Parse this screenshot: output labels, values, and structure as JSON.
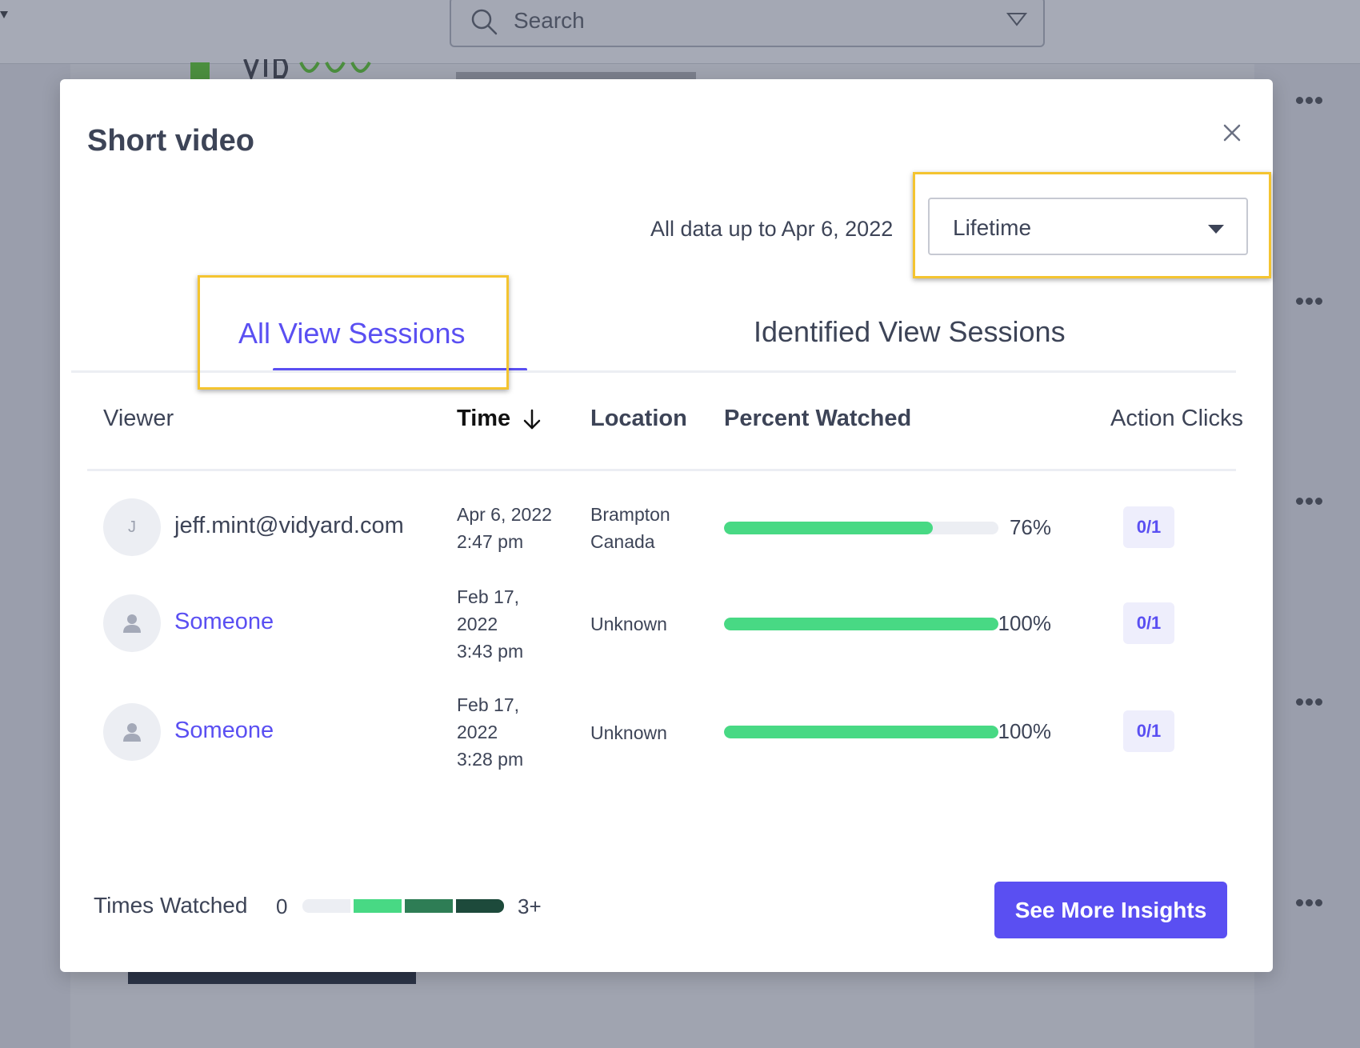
{
  "background": {
    "search_placeholder": "Search"
  },
  "modal": {
    "title": "Short video",
    "data_note": "All data up to Apr 6, 2022",
    "range_select": {
      "value": "Lifetime"
    },
    "tabs": [
      {
        "label": "All View Sessions",
        "active": true
      },
      {
        "label": "Identified View Sessions",
        "active": false
      }
    ],
    "columns": {
      "viewer": "Viewer",
      "time": "Time",
      "location": "Location",
      "percent": "Percent Watched",
      "actions": "Action Clicks"
    },
    "rows": [
      {
        "avatar_initial": "J",
        "viewer": "jeff.mint@vidyard.com",
        "time_lines": [
          "Apr 6, 2022",
          "2:47 pm"
        ],
        "location_lines": [
          "Brampton",
          "Canada"
        ],
        "percent_value": 0.76,
        "percent_label": "76%",
        "action_clicks": "0/1"
      },
      {
        "avatar_initial": "",
        "viewer": "Someone",
        "time_lines": [
          "Feb 17,",
          "2022",
          "3:43 pm"
        ],
        "location_lines": [
          "Unknown"
        ],
        "percent_value": 1.0,
        "percent_label": "100%",
        "action_clicks": "0/1"
      },
      {
        "avatar_initial": "",
        "viewer": "Someone",
        "time_lines": [
          "Feb 17,",
          "2022",
          "3:28 pm"
        ],
        "location_lines": [
          "Unknown"
        ],
        "percent_value": 1.0,
        "percent_label": "100%",
        "action_clicks": "0/1"
      }
    ],
    "legend": {
      "label": "Times Watched",
      "min": "0",
      "max": "3+",
      "colors": [
        "#eceef3",
        "#48d984",
        "#2e7d55",
        "#1d4a3b"
      ]
    },
    "cta_label": "See More Insights"
  },
  "colors": {
    "accent": "#5a4ff2",
    "progress": "#48d984",
    "highlight": "#f4c430"
  }
}
